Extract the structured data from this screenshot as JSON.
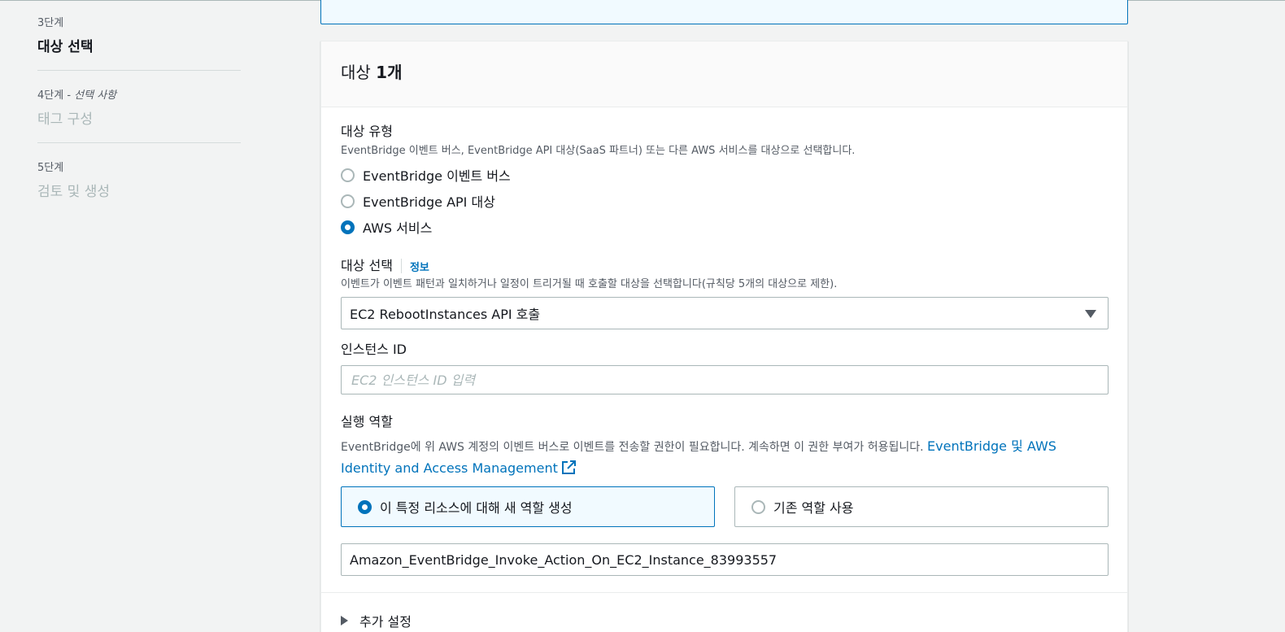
{
  "steps": [
    {
      "num": "3단계",
      "optional": "",
      "title": "대상 선택",
      "active": true
    },
    {
      "num": "4단계 - ",
      "optional": "선택 사항",
      "title": "태그 구성",
      "active": false
    },
    {
      "num": "5단계",
      "optional": "",
      "title": "검토 및 생성",
      "active": false
    }
  ],
  "panel": {
    "title_prefix": "대상 ",
    "title_count": "1개"
  },
  "target_type": {
    "label": "대상 유형",
    "description": "EventBridge 이벤트 버스, EventBridge API 대상(SaaS 파트너) 또는 다른 AWS 서비스를 대상으로 선택합니다.",
    "options": [
      {
        "label": "EventBridge 이벤트 버스",
        "checked": false
      },
      {
        "label": "EventBridge API 대상",
        "checked": false
      },
      {
        "label": "AWS 서비스",
        "checked": true
      }
    ]
  },
  "select_target": {
    "label": "대상 선택",
    "info": "정보",
    "description": "이벤트가 이벤트 패턴과 일치하거나 일정이 트리거될 때 호출할 대상을 선택합니다(규칙당 5개의 대상으로 제한).",
    "value": "EC2 RebootInstances API 호출"
  },
  "instance_id": {
    "label": "인스턴스 ID",
    "value": "",
    "placeholder": "EC2 인스턴스 ID 입력"
  },
  "execution_role": {
    "label": "실행 역할",
    "description": "EventBridge에 위 AWS 계정의 이벤트 버스로 이벤트를 전송할 권한이 필요합니다. 계속하면 이 권한 부여가 허용됩니다. ",
    "link": "EventBridge 및 AWS Identity and Access Management",
    "tiles": [
      {
        "label": "이 특정 리소스에 대해 새 역할 생성",
        "selected": true
      },
      {
        "label": "기존 역할 사용",
        "selected": false
      }
    ],
    "role_name": "Amazon_EventBridge_Invoke_Action_On_EC2_Instance_83993557"
  },
  "additional_settings": "추가 설정",
  "colors": {
    "accent": "#0073bb",
    "muted": "#545b64",
    "border": "#aab7b8"
  },
  "icons": {
    "external_link": "external-link-icon",
    "caret": "caret-down-icon",
    "expand": "triangle-right-icon"
  }
}
